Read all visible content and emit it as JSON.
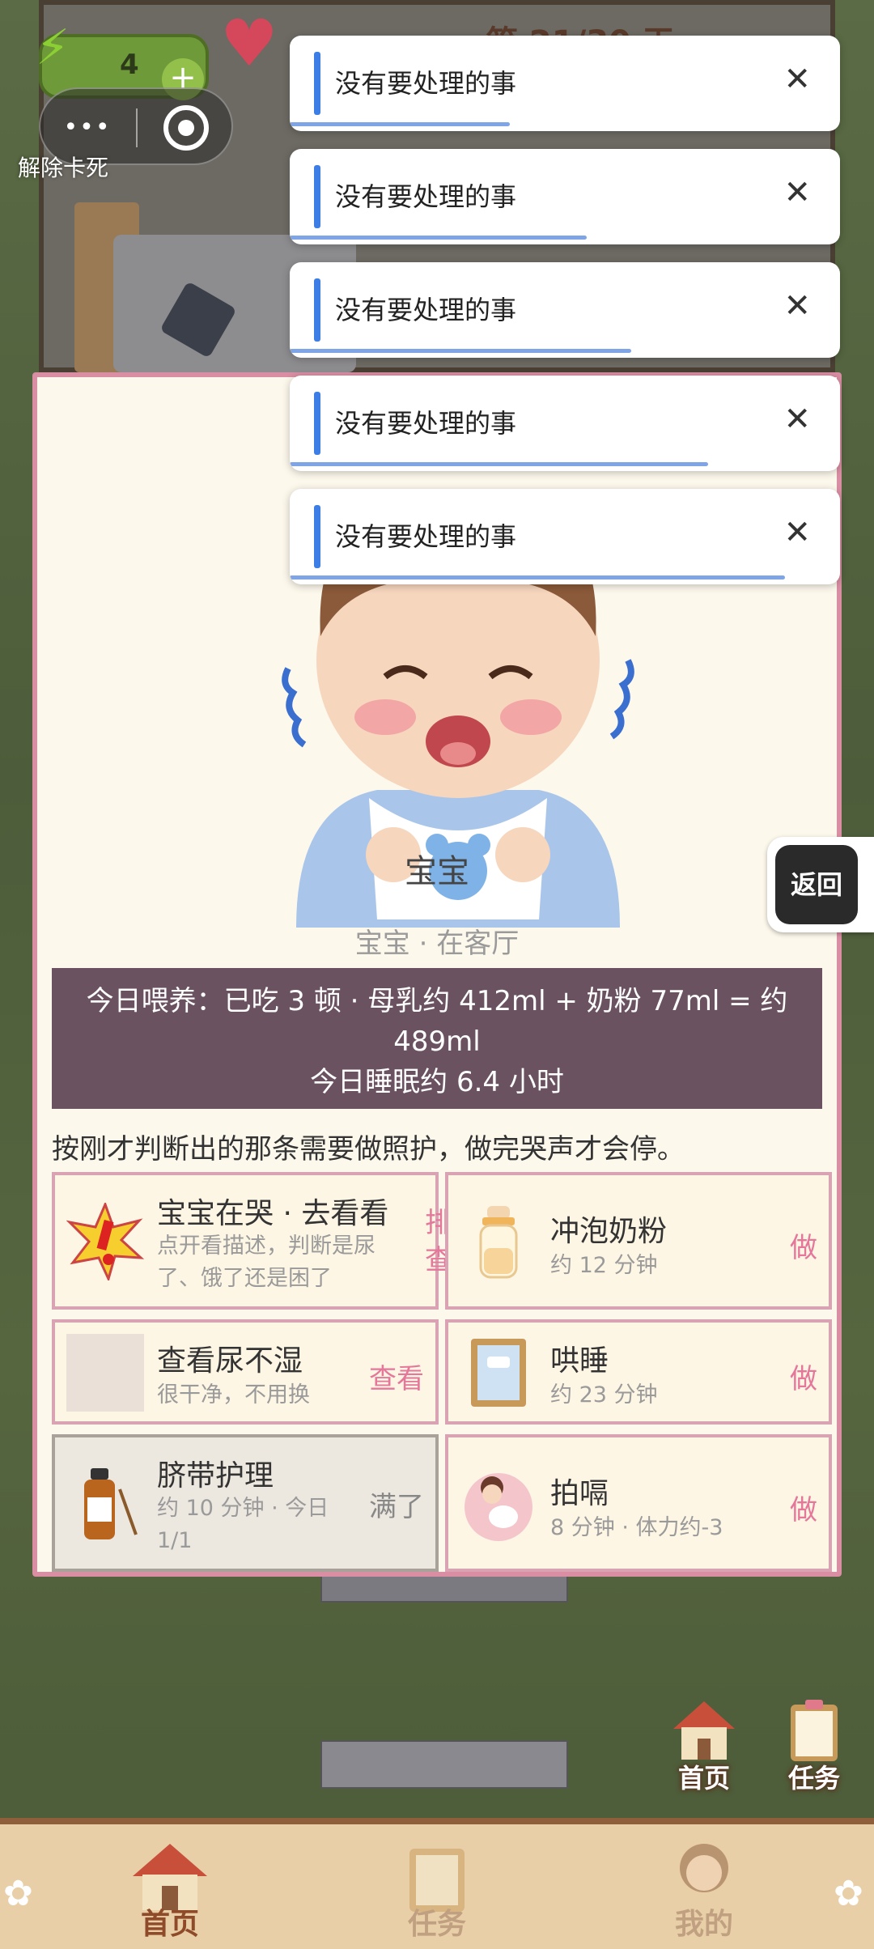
{
  "hud": {
    "energy": "4",
    "energy_plus": "+",
    "day": "第 21/30 天",
    "unstuck": "解除卡死",
    "capsule_more": "•••"
  },
  "toasts": [
    {
      "text": "没有要处理的事",
      "close": "✕",
      "progress": 0.4
    },
    {
      "text": "没有要处理的事",
      "close": "✕",
      "progress": 0.54
    },
    {
      "text": "没有要处理的事",
      "close": "✕",
      "progress": 0.62
    },
    {
      "text": "没有要处理的事",
      "close": "✕",
      "progress": 0.76
    },
    {
      "text": "没有要处理的事",
      "close": "✕",
      "progress": 0.9
    }
  ],
  "modal": {
    "name": "宝宝",
    "location": "宝宝 · 在客厅",
    "stats_line1": "今日喂养：已吃 3 顿 · 母乳约 412ml + 奶粉 77ml = 约",
    "stats_line2": "489ml",
    "stats_line3": "今日睡眠约 6.4 小时",
    "hint": "按刚才判断出的那条需要做照护，做完哭声才会停。",
    "cards": {
      "crying": {
        "title": "宝宝在哭 · 去看看",
        "sub": "点开看描述，判断是尿了、饿了还是困了",
        "action": "排查"
      },
      "formula": {
        "title": "冲泡奶粉",
        "sub": "约 12 分钟",
        "action": "做"
      },
      "diaper": {
        "title": "查看尿不湿",
        "sub": "很干净，不用换",
        "action": "查看"
      },
      "sleep": {
        "title": "哄睡",
        "sub": "约 23 分钟",
        "action": "做"
      },
      "navel": {
        "title": "脐带护理",
        "sub": "约 10 分钟 · 今日 1/1",
        "action": "满了"
      },
      "burp": {
        "title": "拍嗝",
        "sub": "8 分钟 · 体力约-3",
        "action": "做"
      }
    }
  },
  "back_button": "返回",
  "shortcuts": {
    "home": "首页",
    "tasks": "任务"
  },
  "nav": {
    "home": "首页",
    "tasks": "任务",
    "me": "我的"
  },
  "colors": {
    "accent": "#e4779a",
    "stats_bg": "#6b5261",
    "toast_bar": "#3d7ee6",
    "modal_border": "#d98ea3"
  }
}
